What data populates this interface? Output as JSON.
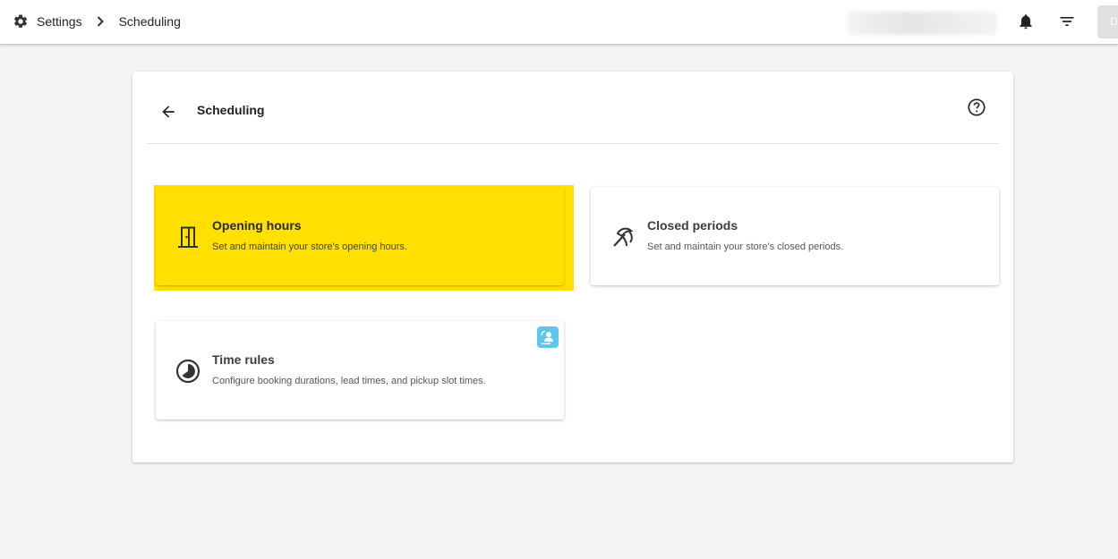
{
  "topbar": {
    "breadcrumb": [
      {
        "label": "Settings"
      },
      {
        "label": "Scheduling"
      }
    ],
    "icons": [
      "gear-icon",
      "chevron-right-icon",
      "bell-icon",
      "filter-icon"
    ],
    "avatar_initial": "D"
  },
  "panel": {
    "title": "Scheduling",
    "cards": [
      {
        "title": "Opening hours",
        "description": "Set and maintain your store's opening hours.",
        "icon": "door-icon",
        "highlighted": true
      },
      {
        "title": "Closed periods",
        "description": "Set and maintain your store's closed periods.",
        "icon": "umbrella-icon"
      },
      {
        "title": "Time rules",
        "description": "Configure booking durations, lead times, and pickup slot times.",
        "icon": "clock-icon",
        "badge_icon": "support-icon"
      }
    ]
  },
  "colors": {
    "highlight": "#ffe000",
    "badge": "#5bc8ea",
    "background": "#f4f4f4"
  }
}
